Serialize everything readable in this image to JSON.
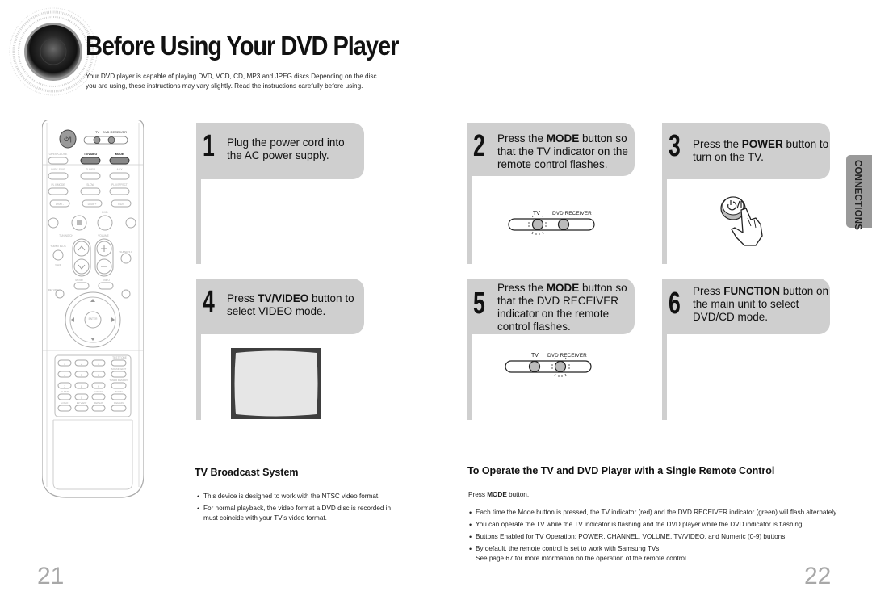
{
  "header": {
    "title": "Before Using Your DVD Player",
    "intro_line1": "Your DVD player is capable of playing DVD, VCD, CD, MP3 and JPEG discs.Depending on the disc",
    "intro_line2": "you are using, these instructions may vary slightly. Read the instructions carefully before using."
  },
  "remote": {
    "labels": {
      "tv": "TV",
      "dvd_receiver": "DVD RECEIVER",
      "open_close": "OPEN/CLOSE",
      "tv_video": "TV/VIDEO",
      "mode": "MODE",
      "disc_skip": "DISC SKIP",
      "tuner": "TUNER",
      "band": "BAND",
      "aux": "AUX",
      "pl2_mode": "PL II MODE",
      "slow": "SLOW",
      "mo_st": "MO/ST",
      "pl2_effect": "PL II EFFECT",
      "dsm_minus": "DSM -",
      "dsm_plus": "DSM +",
      "rds": "RDS",
      "dvd": "DVD",
      "tuning_ch": "TUNING/CH",
      "volume": "VOLUME",
      "turbo_plus": "TURBO PLUS",
      "v_hp": "V-H/P",
      "super51": "SUPER 5.1",
      "menu": "MENU",
      "info": "INFO",
      "return": "RETURN",
      "enter": "ENTER",
      "test_tone": "TEST TONE",
      "sound_edit": "SOUND EDIT",
      "tuner_memory": "TUNER MEMORY",
      "sleep": "SLEEP",
      "cancel": "CANCEL",
      "zoom": "ZOOM",
      "logo": "LOGO",
      "ez_view": "EZ VIEW",
      "repeat": "REPEAT",
      "remain": "REMAIN",
      "digits": [
        "1",
        "2",
        "3",
        "4",
        "5",
        "6",
        "7",
        "8",
        "9",
        "0"
      ]
    }
  },
  "steps": [
    {
      "number": "1",
      "pre": "Plug the power cord into the AC power supply.",
      "bold": "",
      "post": ""
    },
    {
      "number": "2",
      "pre": "Press the ",
      "bold": "MODE",
      "post": " button so that the TV indicator on the remote control flashes."
    },
    {
      "number": "3",
      "pre": "Press the ",
      "bold": "POWER",
      "post": " button to turn on the TV."
    },
    {
      "number": "4",
      "pre": "Press ",
      "bold": "TV/VIDEO",
      "post": " button to select VIDEO mode."
    },
    {
      "number": "5",
      "pre": "Press the ",
      "bold": "MODE",
      "post": " button so that the DVD RECEIVER indicator on the remote control flashes."
    },
    {
      "number": "6",
      "pre": "Press ",
      "bold": "FUNCTION",
      "post": " button on the main unit to select DVD/CD mode."
    }
  ],
  "indicator": {
    "tv": "TV",
    "dvd_receiver": "DVD RECEIVER"
  },
  "side_tab": "CONNECTIONS",
  "tv_broadcast": {
    "title_prefix": "TV",
    "title_rest": " Broadcast System",
    "bullets": [
      " This device is designed to work with the NTSC video format.",
      "For normal playback, the video format a DVD disc is recorded in must coincide with your TV's video format."
    ]
  },
  "single_remote": {
    "title_prefix": "To",
    "title_rest": " Operate the TV and DVD Player with a Single Remote Control",
    "press_pre": "Press ",
    "press_bold": "MODE",
    "press_post": " button.",
    "bullets": [
      "Each time the Mode button is pressed, the TV indicator (red) and the DVD RECEIVER indicator (green) will flash alternately.",
      "You can operate the TV while the TV indicator is flashing and the DVD player while the DVD indicator is flashing.",
      "Buttons Enabled for TV Operation: POWER, CHANNEL, VOLUME, TV/VIDEO, and Numeric (0-9) buttons.",
      "By default, the remote control is set to work with Samsung TVs."
    ],
    "note": "See page 67 for more information on the operation of the remote control."
  },
  "page_numbers": {
    "left": "21",
    "right": "22"
  }
}
